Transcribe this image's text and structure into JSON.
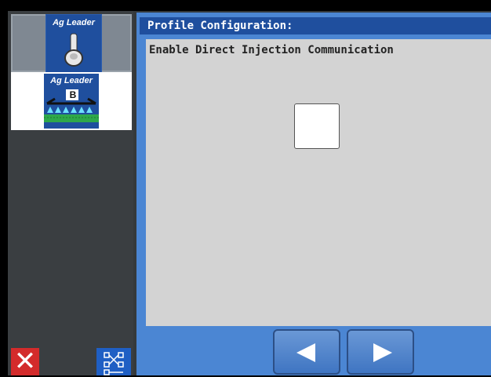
{
  "sidebar": {
    "items": [
      {
        "brand": "Ag Leader",
        "icon": "joystick-icon",
        "state": "selected"
      },
      {
        "brand": "Ag Leader",
        "icon": "boom-sprayer-icon",
        "badge": "B",
        "state": "active"
      }
    ],
    "delete_glyph": "✕",
    "delete_icon": "close-icon",
    "diagram_icon": "network-diagram-icon"
  },
  "main": {
    "title": "Profile Configuration:",
    "option_label": "Enable Direct Injection Communication",
    "checkbox_checked": false
  },
  "navigation": {
    "prev_icon": "left-arrow-icon",
    "next_icon": "right-arrow-icon"
  },
  "colors": {
    "header_blue": "#1f4f9e",
    "panel_blue": "#4b86d3",
    "content_gray": "#d3d3d3",
    "delete_red": "#d32b2b"
  }
}
